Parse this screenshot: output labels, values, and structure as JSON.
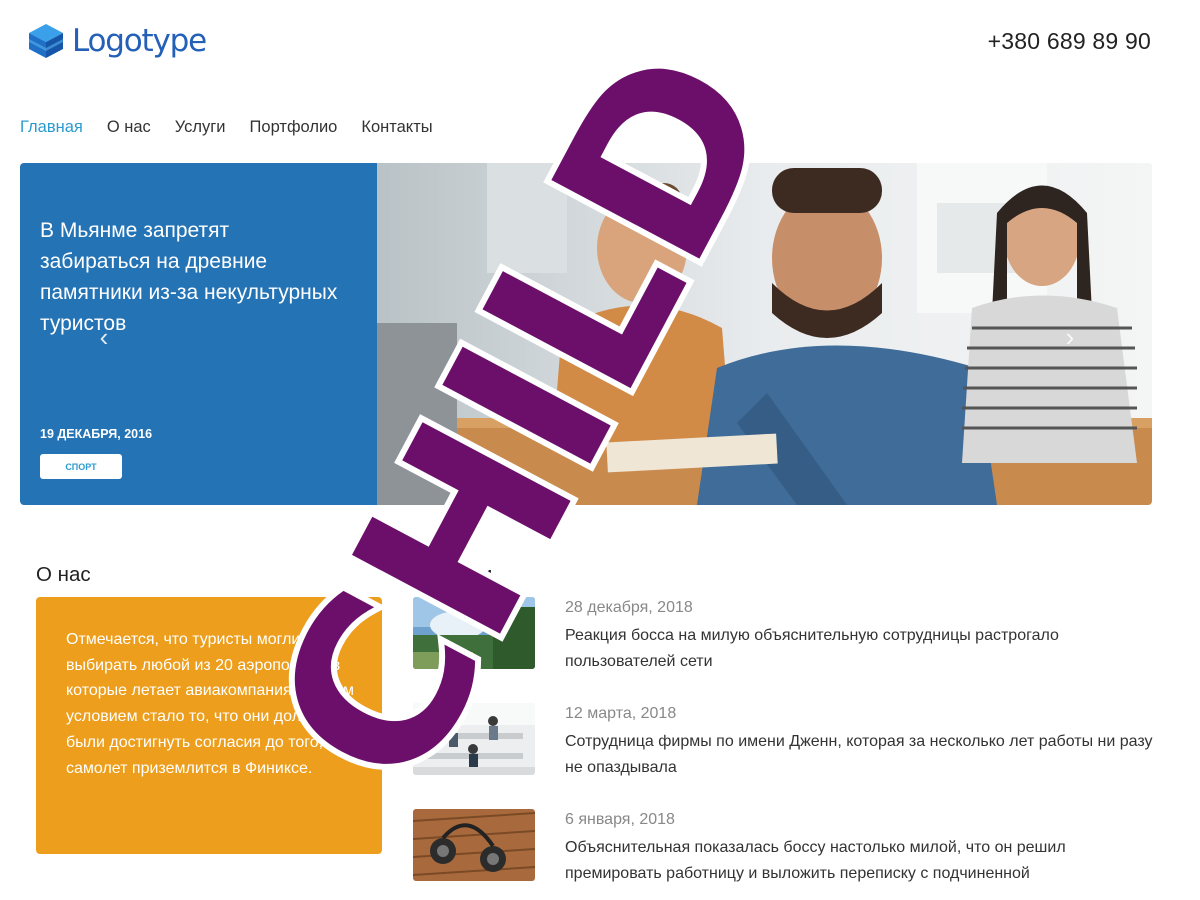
{
  "header": {
    "logo_text": "Logotype",
    "phone": "+380 689 89 90"
  },
  "nav": {
    "items": [
      {
        "label": "Главная",
        "active": true
      },
      {
        "label": "О нас",
        "active": false
      },
      {
        "label": "Услуги",
        "active": false
      },
      {
        "label": "Портфолио",
        "active": false
      },
      {
        "label": "Контакты",
        "active": false
      }
    ]
  },
  "hero": {
    "title": "В Мьянме запретят забираться на древние памятники из-за некультурных туристов",
    "date": "19 ДЕКАБРЯ, 2016",
    "tag": "СПОРТ",
    "prev_icon": "chevron-left-icon",
    "next_icon": "chevron-right-icon"
  },
  "about": {
    "title": "О нас",
    "text": "Отмечается, что туристы могли выбирать любой из 20 аэропортов, в которые летает авиакомпания. Другим условием стало то, что они должны были достигнуть согласия до того, как самолет приземлится в Финиксе."
  },
  "news": {
    "title": "Новости",
    "items": [
      {
        "date": "28 декабря, 2018",
        "text": "Реакция босса на милую объяснительную сотрудницы растрогало пользователей сети"
      },
      {
        "date": "12 марта, 2018",
        "text": "Сотрудница фирмы по имени Дженн, которая за несколько лет работы ни разу не опаздывала"
      },
      {
        "date": "6 января, 2018",
        "text": "Объяснительная показалась боссу настолько милой, что он решил премировать работницу и выложить переписку с подчиненной"
      }
    ]
  },
  "watermark": {
    "text": "CHILD",
    "color": "#6b0f6b"
  },
  "colors": {
    "brand": "#2460b8",
    "nav_active": "#2a9bd0",
    "hero_panel": "#2473b5",
    "about_card": "#ec9e1c"
  }
}
